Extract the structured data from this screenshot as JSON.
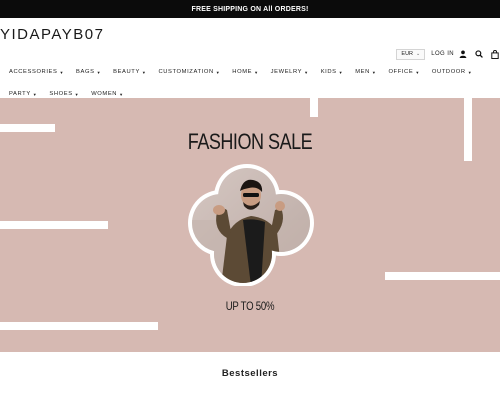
{
  "announcement": "FREE SHIPPING ON All ORDERS!",
  "logo": "YIDAPAYB07",
  "utility": {
    "currency": "EUR",
    "login_label": "LOG IN"
  },
  "icons": {
    "user": "user-icon",
    "search": "search-icon",
    "cart": "cart-icon",
    "caret": "caret-down-icon"
  },
  "nav": {
    "items": [
      {
        "label": "ACCESSORIES"
      },
      {
        "label": "BAGS"
      },
      {
        "label": "BEAUTY"
      },
      {
        "label": "CUSTOMIZATION"
      },
      {
        "label": "HOME"
      },
      {
        "label": "JEWELRY"
      },
      {
        "label": "KIDS"
      },
      {
        "label": "MEN"
      },
      {
        "label": "OFFICE"
      },
      {
        "label": "OUTDOOR"
      },
      {
        "label": "PARTY"
      },
      {
        "label": "SHOES"
      },
      {
        "label": "WOMEN"
      }
    ]
  },
  "hero": {
    "title": "FASHION SALE",
    "subtitle": "UP TO 50%",
    "background_color": "#d6b9b2"
  },
  "bestsellers": {
    "title": "Bestsellers"
  }
}
